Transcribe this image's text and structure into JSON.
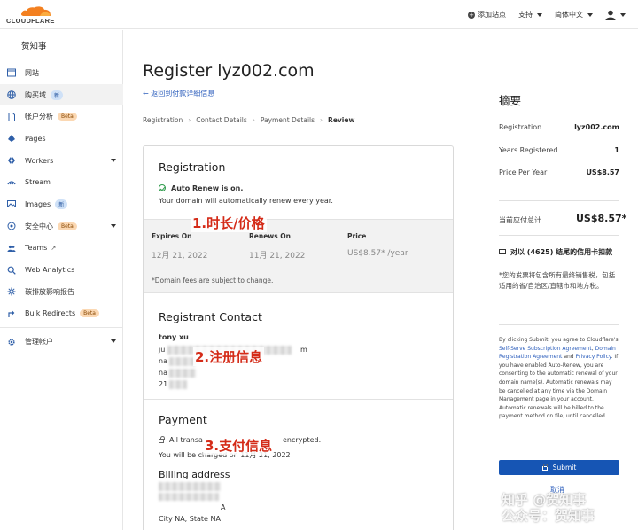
{
  "header": {
    "logo_text": "CLOUDFLARE",
    "add_site": "添加站点",
    "support": "支持",
    "language": "简体中文"
  },
  "sidebar": {
    "account": "贺知事",
    "items": [
      {
        "label": "网站",
        "icon": "browser-icon"
      },
      {
        "label": "购买域",
        "icon": "globe-icon",
        "badge": "新"
      },
      {
        "label": "帐户分析",
        "icon": "document-icon",
        "badge": "Beta"
      },
      {
        "label": "Pages",
        "icon": "pages-icon"
      },
      {
        "label": "Workers",
        "icon": "workers-icon"
      },
      {
        "label": "Stream",
        "icon": "stream-icon"
      },
      {
        "label": "Images",
        "icon": "images-icon",
        "badge": "新"
      },
      {
        "label": "安全中心",
        "icon": "security-icon",
        "badge": "Beta"
      },
      {
        "label": "Teams",
        "icon": "teams-icon"
      },
      {
        "label": "Web Analytics",
        "icon": "analytics-icon"
      },
      {
        "label": "碳排放影响报告",
        "icon": "carbon-icon"
      },
      {
        "label": "Bulk Redirects",
        "icon": "redirect-icon",
        "badge": "Beta"
      },
      {
        "label": "管理帐户",
        "icon": "gear-icon"
      }
    ]
  },
  "main": {
    "title": "Register lyz002.com",
    "back_link": "返回到付款详细信息",
    "breadcrumb": [
      "Registration",
      "Contact Details",
      "Payment Details",
      "Review"
    ],
    "registration": {
      "title": "Registration",
      "auto_renew": "Auto Renew is on.",
      "auto_renew_desc": "Your domain will automatically renew every year.",
      "expires_head": "Expires On",
      "renews_head": "Renews On",
      "price_head": "Price",
      "expires_val": "12月 21, 2022",
      "renews_val": "11月 21, 2022",
      "price_val": "US$8.57* /year",
      "fee_note": "*Domain fees are subject to change."
    },
    "contact": {
      "title": "Registrant Contact",
      "name": "tony xu",
      "email_start": "ju",
      "email_end": "m",
      "line2": "na",
      "line3": "na",
      "line4": "21"
    },
    "payment": {
      "title": "Payment",
      "secure_start": "All transa",
      "secure_end": "encrypted.",
      "charged_start": "You will be charged on",
      "charged_end": "11月 21, 2022",
      "billing_title": "Billing address",
      "addr1_end": "A",
      "addr2": "City NA, State NA"
    },
    "annotations": {
      "a1": "1.时长/价格",
      "a2": "2.注册信息",
      "a3": "3.支付信息"
    }
  },
  "summary": {
    "title": "摘要",
    "reg_label": "Registration",
    "reg_value": "lyz002.com",
    "years_label": "Years Registered",
    "years_value": "1",
    "ppy_label": "Price Per Year",
    "ppy_value": "US$8.57",
    "total_label": "当前应付总计",
    "total_value": "US$8.57*",
    "card_note": "对以 (4625) 结尾的信用卡扣款",
    "tax_note": "*您的发票将包含所有最终销售税，包括适用的省/自治区/直辖市和地方税。",
    "legal_1": "By clicking Submit, you agree to Cloudflare's ",
    "legal_link1": "Self-Serve Subscription Agreement",
    "legal_2": ", ",
    "legal_link2": "Domain Registration Agreement",
    "legal_3": " and ",
    "legal_link3": "Privacy Policy",
    "legal_4": ". If you have enabled Auto-Renew, you are consenting to the automatic renewal of your domain name(s). Automatic renewals may be cancelled at any time via the Domain Management page in your account. Automatic renewals will be billed to the payment method on file, until cancelled.",
    "submit": "Submit",
    "cancel": "取消"
  },
  "watermark": {
    "line1": "知乎 @贺知事",
    "line2": "公众号：贺知事"
  },
  "colors": {
    "brand_orange": "#f38020",
    "primary_blue": "#1655b4",
    "annotation_red": "#d42b18"
  }
}
